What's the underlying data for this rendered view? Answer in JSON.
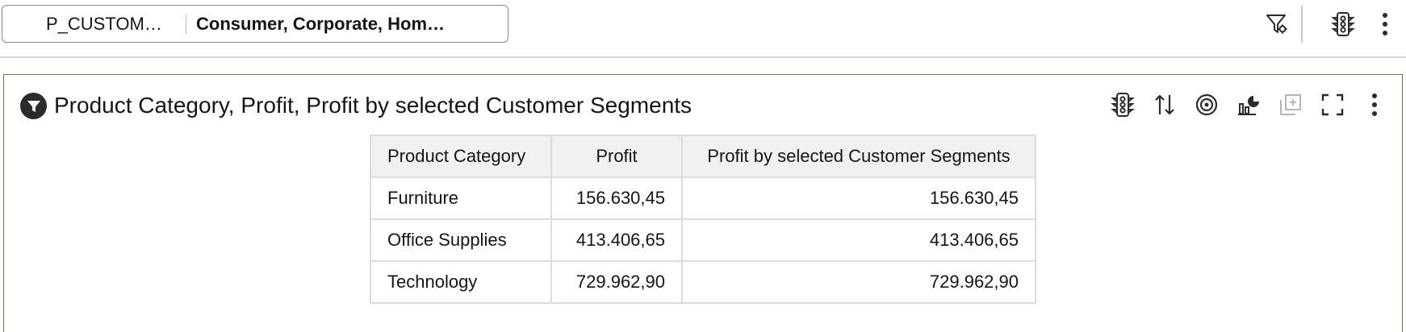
{
  "filter_bar": {
    "parameter_name": "P_CUSTOM…",
    "parameter_value": "Consumer, Corporate, Hom…"
  },
  "top_icons": [
    "filter-settings-icon",
    "traffic-light-icon",
    "more-vertical-icon"
  ],
  "panel": {
    "title": "Product Category, Profit, Profit by selected Customer Segments",
    "tools": [
      "traffic-light-icon",
      "sort-icon",
      "target-icon",
      "chart-type-icon",
      "add-to-canvas-icon",
      "maximize-icon",
      "more-vertical-icon"
    ]
  },
  "table": {
    "headers": [
      "Product Category",
      "Profit",
      "Profit by selected Customer Segments"
    ],
    "rows": [
      {
        "category": "Furniture",
        "profit": "156.630,45",
        "profit_selected": "156.630,45"
      },
      {
        "category": "Office Supplies",
        "profit": "413.406,65",
        "profit_selected": "413.406,65"
      },
      {
        "category": "Technology",
        "profit": "729.962,90",
        "profit_selected": "729.962,90"
      }
    ]
  },
  "colors": {
    "panel_border": "#5f7d4f",
    "header_bg": "#f1f1f1",
    "text": "#161513"
  }
}
